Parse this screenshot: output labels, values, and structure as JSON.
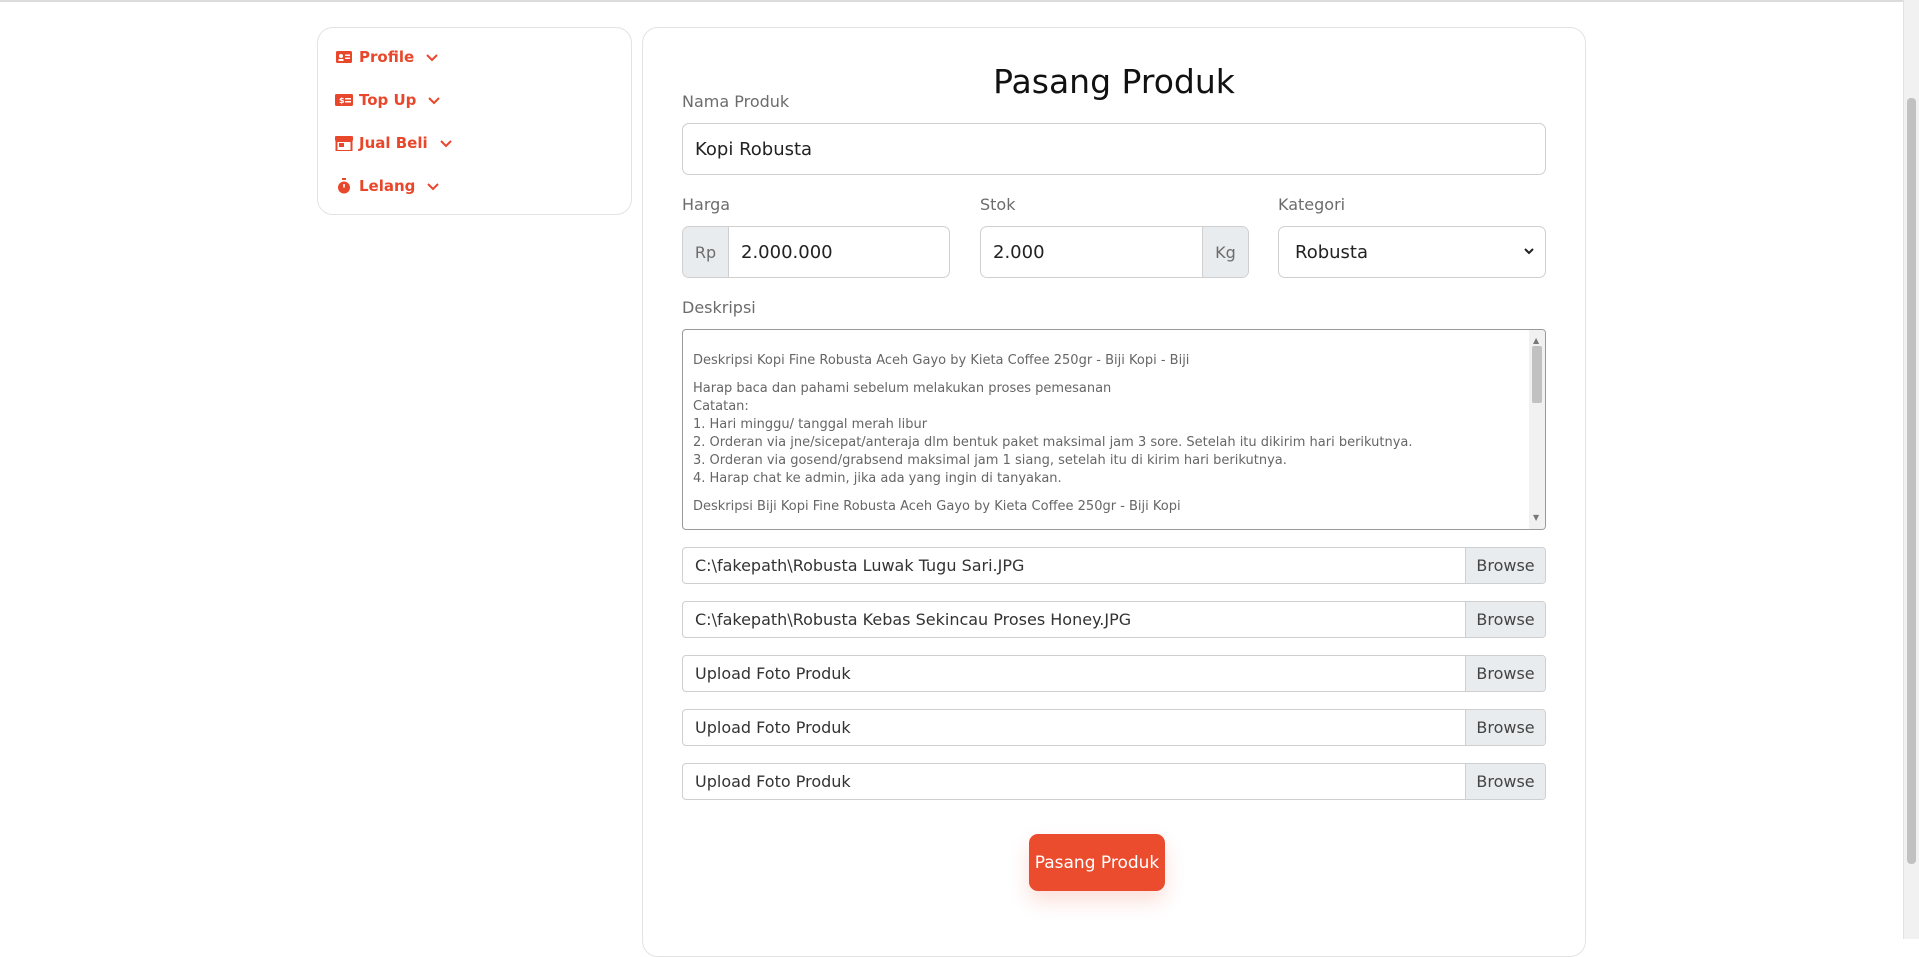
{
  "sidebar": {
    "items": [
      {
        "label": "Profile",
        "icon": "id-card-icon"
      },
      {
        "label": "Top Up",
        "icon": "money-bill-icon"
      },
      {
        "label": "Jual Beli",
        "icon": "store-icon"
      },
      {
        "label": "Lelang",
        "icon": "stopwatch-icon"
      }
    ]
  },
  "form": {
    "title": "Pasang Produk",
    "nama_label": "Nama Produk",
    "nama_value": "Kopi Robusta",
    "harga_label": "Harga",
    "harga_prefix": "Rp",
    "harga_value": "2.000.000",
    "stok_label": "Stok",
    "stok_value": "2.000",
    "stok_suffix": "Kg",
    "kategori_label": "Kategori",
    "kategori_value": "Robusta",
    "deskripsi_label": "Deskripsi",
    "deskripsi_lines": [
      "Deskripsi Kopi Fine Robusta Aceh Gayo by Kieta Coffee 250gr - Biji Kopi - Biji",
      "Harap baca dan pahami sebelum melakukan proses pemesanan",
      "Catatan:",
      "1. Hari minggu/ tanggal merah libur",
      "2. Orderan via jne/sicepat/anteraja dlm bentuk paket maksimal jam 3 sore. Setelah itu dikirim hari berikutnya.",
      "3. Orderan via gosend/grabsend maksimal jam 1 siang, setelah itu di kirim hari berikutnya.",
      "4. Harap chat ke admin, jika ada yang ingin di tanyakan.",
      "Deskripsi Biji Kopi Fine Robusta Aceh Gayo by Kieta Coffee 250gr - Biji Kopi"
    ],
    "files": [
      "C:\\fakepath\\Robusta Luwak Tugu Sari.JPG",
      "C:\\fakepath\\Robusta Kebas Sekincau Proses Honey.JPG",
      "Upload Foto Produk",
      "Upload Foto Produk",
      "Upload Foto Produk"
    ],
    "browse_label": "Browse",
    "submit_label": "Pasang Produk"
  },
  "colors": {
    "accent": "#ea4c2d",
    "addon_bg": "#e9ecef"
  }
}
